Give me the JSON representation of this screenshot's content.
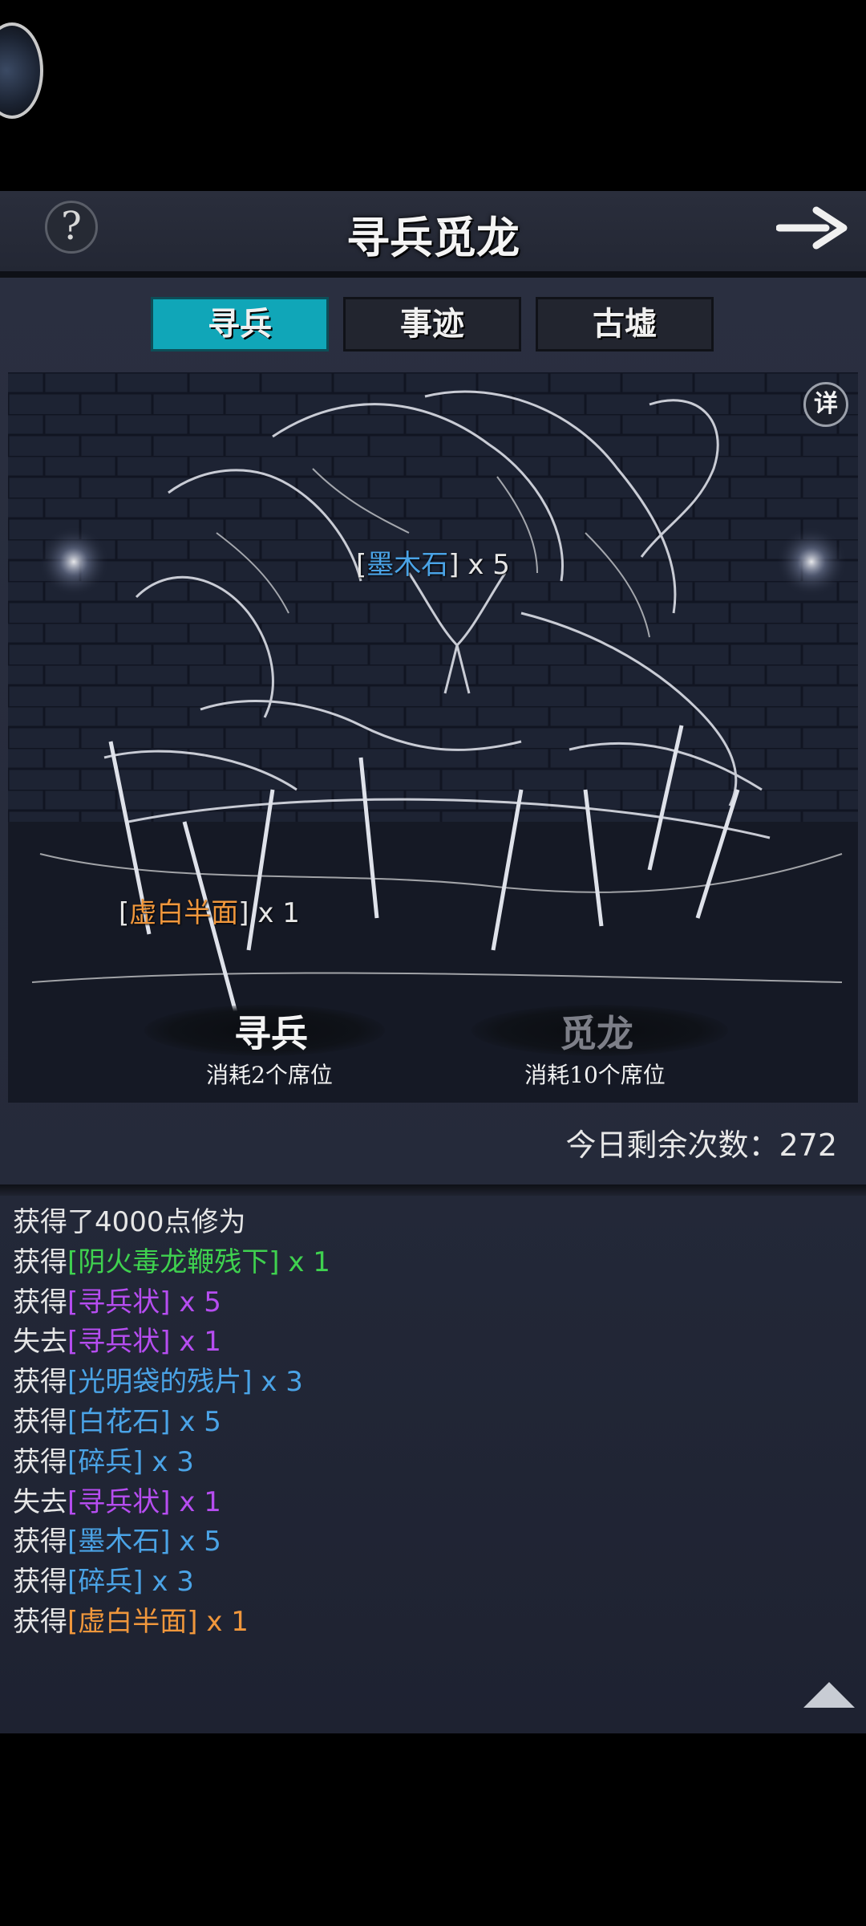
{
  "header": {
    "title": "寻兵觅龙",
    "help_icon": "?"
  },
  "tabs": [
    {
      "label": "寻兵",
      "active": true
    },
    {
      "label": "事迹",
      "active": false
    },
    {
      "label": "古墟",
      "active": false
    }
  ],
  "scene": {
    "detail_button": "详",
    "drops": [
      {
        "open": "[",
        "item": "墨木石",
        "close": "]",
        "qty": " x 5",
        "item_color": "#4aa3e6"
      },
      {
        "open": "[",
        "item": "虚白半面",
        "close": "]",
        "qty": " x 1",
        "item_color": "#f0973c"
      }
    ]
  },
  "actions": {
    "xunbing": {
      "label": "寻兵",
      "cost": "消耗2个席位"
    },
    "milong": {
      "label": "觅龙",
      "cost": "消耗10个席位"
    }
  },
  "remaining_text": "今日剩余次数：272",
  "log": [
    {
      "prefix": "获得了4000点修为",
      "item": "",
      "qty": "",
      "color": "#e6e6e6"
    },
    {
      "prefix": "获得",
      "item": "[阴火毒龙鞭残下]",
      "qty": " x 1",
      "color": "#3fd14f"
    },
    {
      "prefix": "获得",
      "item": "[寻兵状]",
      "qty": " x 5",
      "color": "#b64df0"
    },
    {
      "prefix": "失去",
      "item": "[寻兵状]",
      "qty": " x 1",
      "color": "#b64df0"
    },
    {
      "prefix": "获得",
      "item": "[光明袋的残片]",
      "qty": " x 3",
      "color": "#4aa3e6"
    },
    {
      "prefix": "获得",
      "item": "[白花石]",
      "qty": " x 5",
      "color": "#4aa3e6"
    },
    {
      "prefix": "获得",
      "item": "[碎兵]",
      "qty": " x 3",
      "color": "#4aa3e6"
    },
    {
      "prefix": "失去",
      "item": "[寻兵状]",
      "qty": " x 1",
      "color": "#b64df0"
    },
    {
      "prefix": "获得",
      "item": "[墨木石]",
      "qty": " x 5",
      "color": "#4aa3e6"
    },
    {
      "prefix": "获得",
      "item": "[碎兵]",
      "qty": " x 3",
      "color": "#4aa3e6"
    },
    {
      "prefix": "获得",
      "item": "[虚白半面]",
      "qty": " x 1",
      "color": "#f0973c"
    }
  ],
  "colors": {
    "tab_active": "#10a6b8",
    "blue_item": "#4aa3e6",
    "orange_item": "#f0973c",
    "green_item": "#3fd14f",
    "purple_item": "#b64df0"
  }
}
